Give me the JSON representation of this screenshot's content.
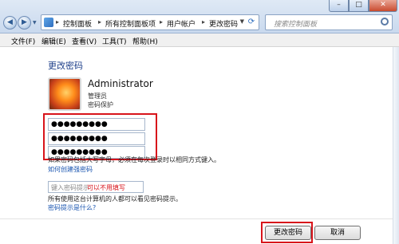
{
  "address_bar": {
    "crumbs": [
      "控制面板",
      "所有控制面板项",
      "用户帐户",
      "更改密码"
    ]
  },
  "search": {
    "placeholder": "搜索控制面板"
  },
  "menu": [
    "文件(F)",
    "编辑(E)",
    "查看(V)",
    "工具(T)",
    "帮助(H)"
  ],
  "page": {
    "title": "更改密码",
    "user": {
      "name": "Administrator",
      "role": "管理员",
      "status": "密码保护"
    },
    "password_fields": [
      "●●●●●●●●●",
      "●●●●●●●●●",
      "●●●●●●●●●"
    ],
    "caps_warning": "如果密码包括大写字母，必须在每次登录时以相同方式键入。",
    "strong_password_link": "如何创建强密码",
    "hint_placeholder": "键入密码提示",
    "hint_note": "可以不用填写",
    "hint_description": "所有使用这台计算机的人都可以看见密码提示。",
    "hint_example_link": "密码提示是什么?"
  },
  "buttons": {
    "ok": "更改密码",
    "cancel": "取消"
  },
  "colors": {
    "highlight_box": "#d8141b",
    "link": "#1a55b0",
    "title": "#1e3f8a"
  },
  "icons": [
    "back-arrow-icon",
    "forward-arrow-icon",
    "control-panel-icon",
    "refresh-icon",
    "search-icon",
    "user-avatar-icon"
  ]
}
